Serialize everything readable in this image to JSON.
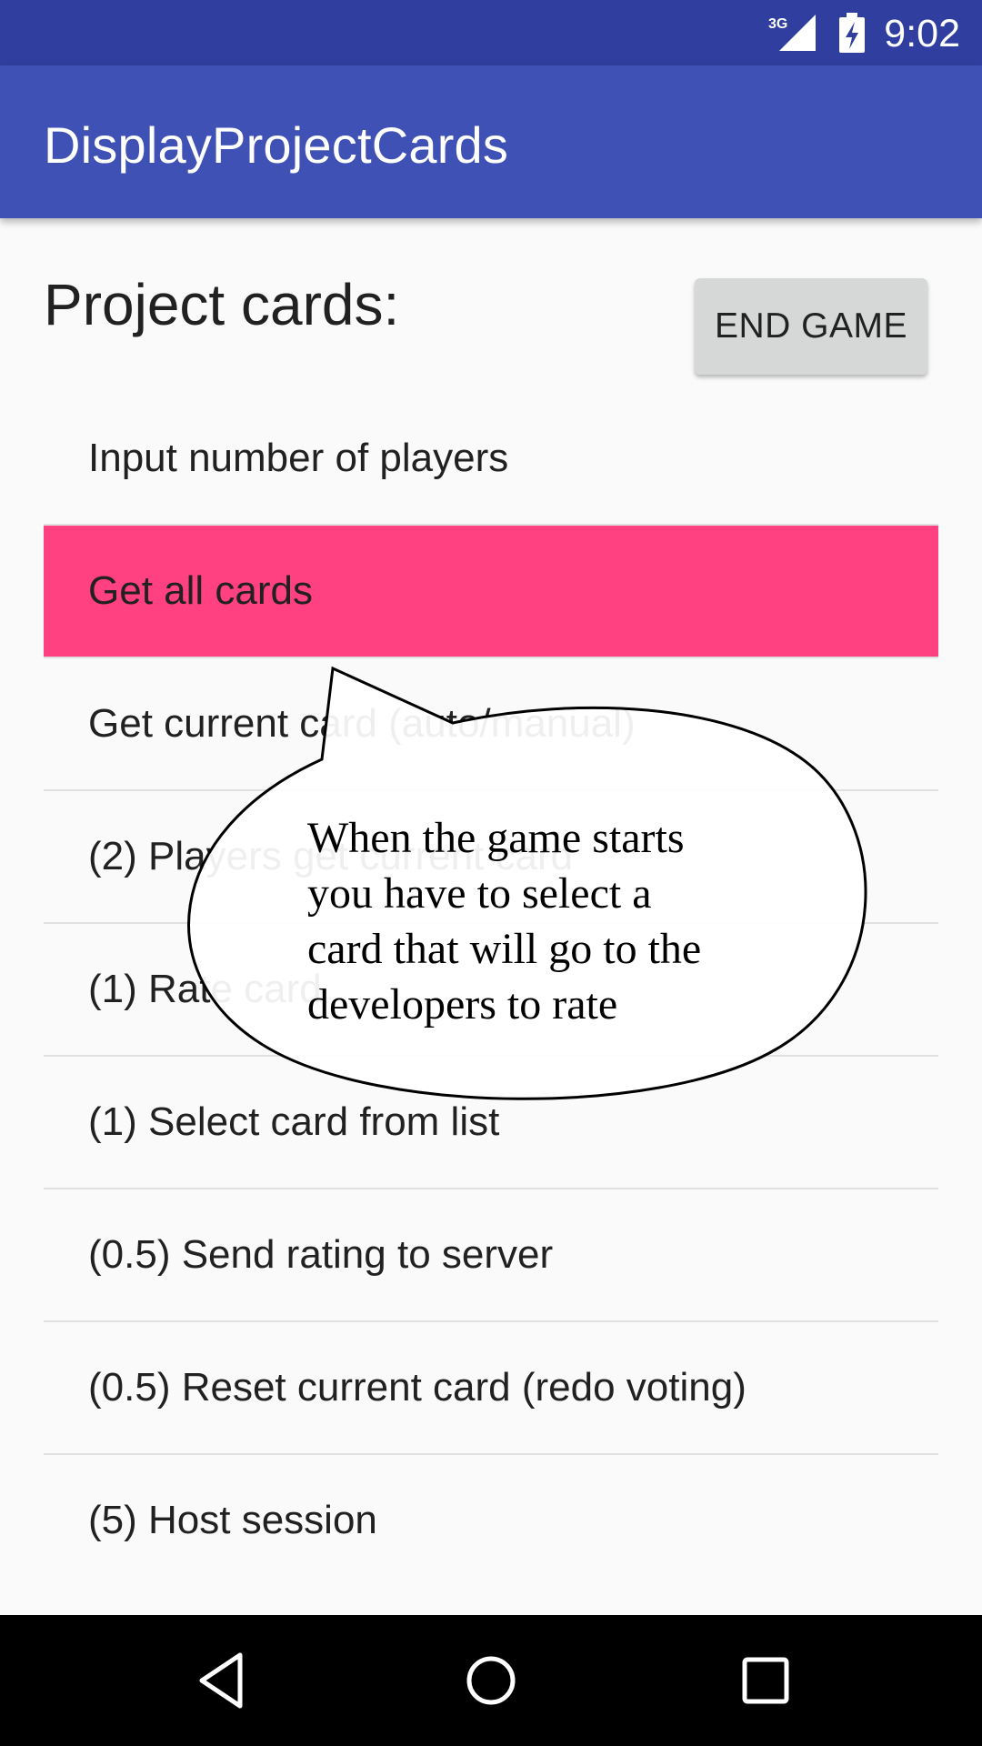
{
  "status_bar": {
    "network_label": "3G",
    "time": "9:02",
    "icons": [
      "signal-3g-icon",
      "battery-charging-icon"
    ]
  },
  "app_bar": {
    "title": "DisplayProjectCards"
  },
  "main": {
    "section_title": "Project cards:",
    "end_game_label": "END GAME",
    "cards": [
      {
        "label": "Input number of players",
        "selected": false
      },
      {
        "label": "Get all cards",
        "selected": true
      },
      {
        "label": "Get current card (auto/manual)",
        "selected": false
      },
      {
        "label": "(2) Players get current card",
        "selected": false
      },
      {
        "label": "(1) Rate card",
        "selected": false
      },
      {
        "label": "(1) Select card from list",
        "selected": false
      },
      {
        "label": "(0.5) Send rating to server",
        "selected": false
      },
      {
        "label": "(0.5) Reset current card (redo voting)",
        "selected": false
      },
      {
        "label": "(5) Host session",
        "selected": false
      }
    ]
  },
  "callout": {
    "lines": [
      "When the game starts",
      "you have to select a",
      "card that will go to the",
      "developers to rate"
    ]
  },
  "nav_bar": {
    "icons": [
      "back-icon",
      "home-icon",
      "recents-icon"
    ]
  },
  "colors": {
    "status_bar": "#303f9f",
    "app_bar": "#3f51b5",
    "accent_selected": "#ff4081",
    "background": "#fafafa",
    "button": "#d6d7d7"
  }
}
